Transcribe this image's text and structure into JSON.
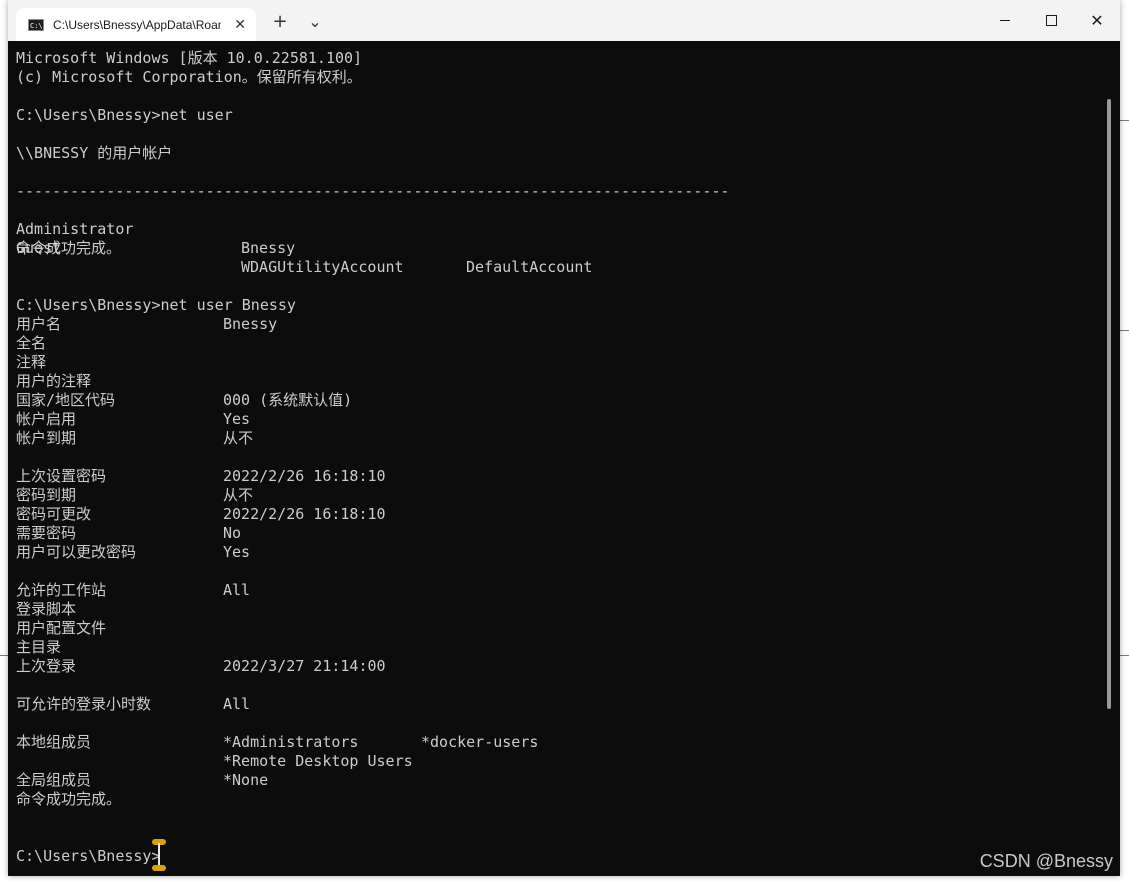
{
  "window": {
    "tab_title": "C:\\Users\\Bnessy\\AppData\\Roam",
    "tab_icon_glyph": "C:\\",
    "new_tab": "+",
    "dropdown": "⌄",
    "tab_close": "✕",
    "close_glyph": "✕"
  },
  "colors": {
    "console_bg": "#0c0c0c",
    "console_fg": "#cccccc",
    "titlebar_bg": "#f3f3f3",
    "cursor_handle": "#d9a400"
  },
  "console": {
    "lines": [
      "Microsoft Windows [版本 10.0.22581.100]",
      "(c) Microsoft Corporation。保留所有权利。",
      "",
      "C:\\Users\\Bnessy>net user",
      "",
      "\\\\BNESSY 的用户帐户",
      "",
      "-------------------------------------------------------------------------------"
    ],
    "accounts_row1": [
      "Administrator",
      "Bnessy",
      "DefaultAccount"
    ],
    "accounts_row2": [
      "Guest",
      "WDAGUtilityAccount"
    ],
    "done1": "命令成功完成。",
    "cmd2": "C:\\Users\\Bnessy>net user Bnessy",
    "fields": [
      {
        "label": "用户名",
        "value": "Bnessy"
      },
      {
        "label": "全名",
        "value": ""
      },
      {
        "label": "注释",
        "value": ""
      },
      {
        "label": "用户的注释",
        "value": ""
      },
      {
        "label": "国家/地区代码",
        "value": "000 (系统默认值)"
      },
      {
        "label": "帐户启用",
        "value": "Yes"
      },
      {
        "label": "帐户到期",
        "value": "从不"
      },
      {
        "label": "",
        "value": ""
      },
      {
        "label": "上次设置密码",
        "value": "2022/2/26 16:18:10"
      },
      {
        "label": "密码到期",
        "value": "从不"
      },
      {
        "label": "密码可更改",
        "value": "2022/2/26 16:18:10"
      },
      {
        "label": "需要密码",
        "value": "No"
      },
      {
        "label": "用户可以更改密码",
        "value": "Yes"
      },
      {
        "label": "",
        "value": ""
      },
      {
        "label": "允许的工作站",
        "value": "All"
      },
      {
        "label": "登录脚本",
        "value": ""
      },
      {
        "label": "用户配置文件",
        "value": ""
      },
      {
        "label": "主目录",
        "value": ""
      },
      {
        "label": "上次登录",
        "value": "2022/3/27 21:14:00"
      },
      {
        "label": "",
        "value": ""
      },
      {
        "label": "可允许的登录小时数",
        "value": "All"
      },
      {
        "label": "",
        "value": ""
      },
      {
        "label": "本地组成员",
        "value": "*Administrators",
        "value2": "*docker-users"
      },
      {
        "label": "",
        "value": "*Remote Desktop Users"
      },
      {
        "label": "全局组成员",
        "value": "*None"
      }
    ],
    "done2": "命令成功完成。",
    "prompt": "C:\\Users\\Bnessy>"
  },
  "watermark": "CSDN @Bnessy"
}
